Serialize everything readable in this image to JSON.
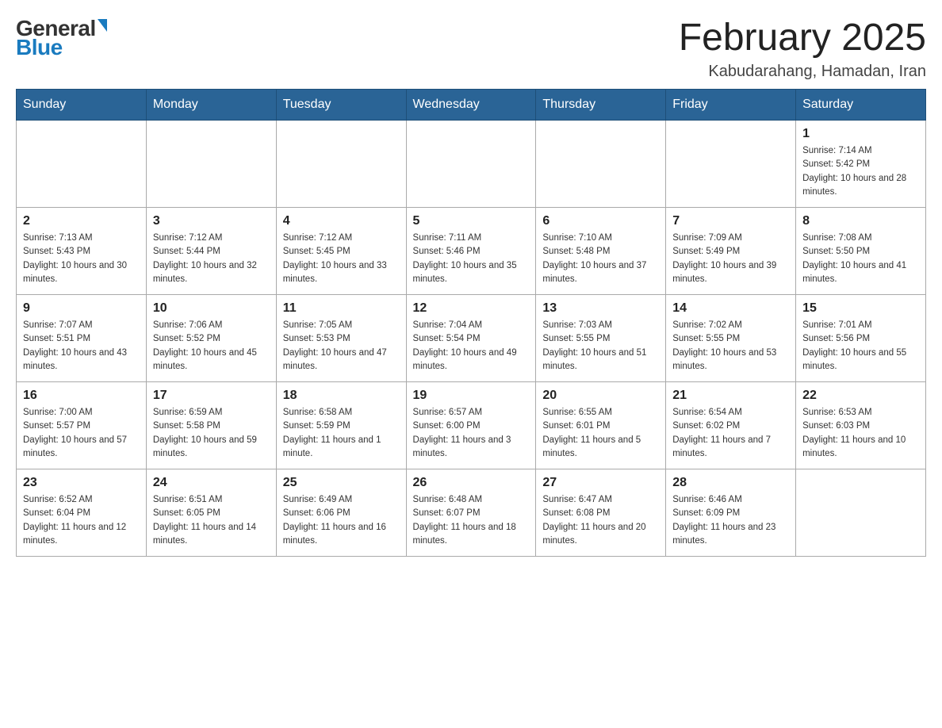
{
  "header": {
    "logo_general": "General",
    "logo_blue": "Blue",
    "title": "February 2025",
    "location": "Kabudarahang, Hamadan, Iran"
  },
  "weekdays": [
    "Sunday",
    "Monday",
    "Tuesday",
    "Wednesday",
    "Thursday",
    "Friday",
    "Saturday"
  ],
  "weeks": [
    [
      {
        "day": "",
        "sunrise": "",
        "sunset": "",
        "daylight": ""
      },
      {
        "day": "",
        "sunrise": "",
        "sunset": "",
        "daylight": ""
      },
      {
        "day": "",
        "sunrise": "",
        "sunset": "",
        "daylight": ""
      },
      {
        "day": "",
        "sunrise": "",
        "sunset": "",
        "daylight": ""
      },
      {
        "day": "",
        "sunrise": "",
        "sunset": "",
        "daylight": ""
      },
      {
        "day": "",
        "sunrise": "",
        "sunset": "",
        "daylight": ""
      },
      {
        "day": "1",
        "sunrise": "Sunrise: 7:14 AM",
        "sunset": "Sunset: 5:42 PM",
        "daylight": "Daylight: 10 hours and 28 minutes."
      }
    ],
    [
      {
        "day": "2",
        "sunrise": "Sunrise: 7:13 AM",
        "sunset": "Sunset: 5:43 PM",
        "daylight": "Daylight: 10 hours and 30 minutes."
      },
      {
        "day": "3",
        "sunrise": "Sunrise: 7:12 AM",
        "sunset": "Sunset: 5:44 PM",
        "daylight": "Daylight: 10 hours and 32 minutes."
      },
      {
        "day": "4",
        "sunrise": "Sunrise: 7:12 AM",
        "sunset": "Sunset: 5:45 PM",
        "daylight": "Daylight: 10 hours and 33 minutes."
      },
      {
        "day": "5",
        "sunrise": "Sunrise: 7:11 AM",
        "sunset": "Sunset: 5:46 PM",
        "daylight": "Daylight: 10 hours and 35 minutes."
      },
      {
        "day": "6",
        "sunrise": "Sunrise: 7:10 AM",
        "sunset": "Sunset: 5:48 PM",
        "daylight": "Daylight: 10 hours and 37 minutes."
      },
      {
        "day": "7",
        "sunrise": "Sunrise: 7:09 AM",
        "sunset": "Sunset: 5:49 PM",
        "daylight": "Daylight: 10 hours and 39 minutes."
      },
      {
        "day": "8",
        "sunrise": "Sunrise: 7:08 AM",
        "sunset": "Sunset: 5:50 PM",
        "daylight": "Daylight: 10 hours and 41 minutes."
      }
    ],
    [
      {
        "day": "9",
        "sunrise": "Sunrise: 7:07 AM",
        "sunset": "Sunset: 5:51 PM",
        "daylight": "Daylight: 10 hours and 43 minutes."
      },
      {
        "day": "10",
        "sunrise": "Sunrise: 7:06 AM",
        "sunset": "Sunset: 5:52 PM",
        "daylight": "Daylight: 10 hours and 45 minutes."
      },
      {
        "day": "11",
        "sunrise": "Sunrise: 7:05 AM",
        "sunset": "Sunset: 5:53 PM",
        "daylight": "Daylight: 10 hours and 47 minutes."
      },
      {
        "day": "12",
        "sunrise": "Sunrise: 7:04 AM",
        "sunset": "Sunset: 5:54 PM",
        "daylight": "Daylight: 10 hours and 49 minutes."
      },
      {
        "day": "13",
        "sunrise": "Sunrise: 7:03 AM",
        "sunset": "Sunset: 5:55 PM",
        "daylight": "Daylight: 10 hours and 51 minutes."
      },
      {
        "day": "14",
        "sunrise": "Sunrise: 7:02 AM",
        "sunset": "Sunset: 5:55 PM",
        "daylight": "Daylight: 10 hours and 53 minutes."
      },
      {
        "day": "15",
        "sunrise": "Sunrise: 7:01 AM",
        "sunset": "Sunset: 5:56 PM",
        "daylight": "Daylight: 10 hours and 55 minutes."
      }
    ],
    [
      {
        "day": "16",
        "sunrise": "Sunrise: 7:00 AM",
        "sunset": "Sunset: 5:57 PM",
        "daylight": "Daylight: 10 hours and 57 minutes."
      },
      {
        "day": "17",
        "sunrise": "Sunrise: 6:59 AM",
        "sunset": "Sunset: 5:58 PM",
        "daylight": "Daylight: 10 hours and 59 minutes."
      },
      {
        "day": "18",
        "sunrise": "Sunrise: 6:58 AM",
        "sunset": "Sunset: 5:59 PM",
        "daylight": "Daylight: 11 hours and 1 minute."
      },
      {
        "day": "19",
        "sunrise": "Sunrise: 6:57 AM",
        "sunset": "Sunset: 6:00 PM",
        "daylight": "Daylight: 11 hours and 3 minutes."
      },
      {
        "day": "20",
        "sunrise": "Sunrise: 6:55 AM",
        "sunset": "Sunset: 6:01 PM",
        "daylight": "Daylight: 11 hours and 5 minutes."
      },
      {
        "day": "21",
        "sunrise": "Sunrise: 6:54 AM",
        "sunset": "Sunset: 6:02 PM",
        "daylight": "Daylight: 11 hours and 7 minutes."
      },
      {
        "day": "22",
        "sunrise": "Sunrise: 6:53 AM",
        "sunset": "Sunset: 6:03 PM",
        "daylight": "Daylight: 11 hours and 10 minutes."
      }
    ],
    [
      {
        "day": "23",
        "sunrise": "Sunrise: 6:52 AM",
        "sunset": "Sunset: 6:04 PM",
        "daylight": "Daylight: 11 hours and 12 minutes."
      },
      {
        "day": "24",
        "sunrise": "Sunrise: 6:51 AM",
        "sunset": "Sunset: 6:05 PM",
        "daylight": "Daylight: 11 hours and 14 minutes."
      },
      {
        "day": "25",
        "sunrise": "Sunrise: 6:49 AM",
        "sunset": "Sunset: 6:06 PM",
        "daylight": "Daylight: 11 hours and 16 minutes."
      },
      {
        "day": "26",
        "sunrise": "Sunrise: 6:48 AM",
        "sunset": "Sunset: 6:07 PM",
        "daylight": "Daylight: 11 hours and 18 minutes."
      },
      {
        "day": "27",
        "sunrise": "Sunrise: 6:47 AM",
        "sunset": "Sunset: 6:08 PM",
        "daylight": "Daylight: 11 hours and 20 minutes."
      },
      {
        "day": "28",
        "sunrise": "Sunrise: 6:46 AM",
        "sunset": "Sunset: 6:09 PM",
        "daylight": "Daylight: 11 hours and 23 minutes."
      },
      {
        "day": "",
        "sunrise": "",
        "sunset": "",
        "daylight": ""
      }
    ]
  ]
}
